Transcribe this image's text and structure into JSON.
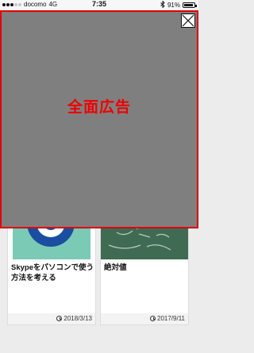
{
  "status_bar": {
    "carrier": "docomo",
    "network": "4G",
    "time": "7:35",
    "battery_percent": "91%",
    "battery_level": 0.91
  },
  "ad": {
    "text": "全面広告",
    "border_color": "#e00000",
    "text_color": "#f00000",
    "close_icon": "close-x-icon"
  },
  "cards": [
    {
      "title": "Skypeをパソコンで使う方法を考える",
      "date": "2018/3/13",
      "thumb_icon": "skype-logo"
    },
    {
      "title": "絶対値",
      "date": "2017/9/11",
      "thumb_icon": "chalkboard-image"
    }
  ]
}
